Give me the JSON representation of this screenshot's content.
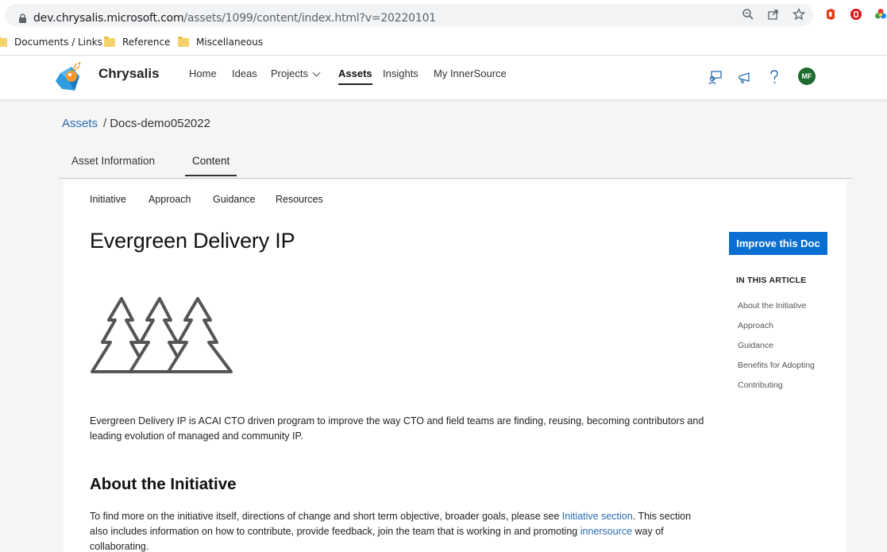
{
  "browser": {
    "url_host": "dev.chrysalis.microsoft.com",
    "url_path": "/assets/1099/content/index.html?v=20220101",
    "bookmarks": [
      "Documents / Links",
      "Reference",
      "Miscellaneous"
    ]
  },
  "header": {
    "brand": "Chrysalis",
    "nav": [
      "Home",
      "Ideas",
      "Projects",
      "Assets",
      "Insights",
      "My InnerSource"
    ],
    "active_nav": "Assets",
    "avatar_initials": "MF",
    "icons": [
      "feedback-icon",
      "announcement-icon",
      "help-icon"
    ]
  },
  "breadcrumb": {
    "link": "Assets",
    "separator": "/",
    "current": "Docs-demo052022"
  },
  "tabs": {
    "items": [
      "Asset Information",
      "Content"
    ],
    "active": "Content"
  },
  "content": {
    "subnav": [
      "Initiative",
      "Approach",
      "Guidance",
      "Resources"
    ],
    "title": "Evergreen Delivery IP",
    "improve_button": "Improve this Doc",
    "toc": {
      "heading": "IN THIS ARTICLE",
      "items": [
        "About the Initiative",
        "Approach",
        "Guidance",
        "Benefits for Adopting",
        "Contributing"
      ]
    },
    "intro": "Evergreen Delivery IP is ACAI CTO driven program to improve the way CTO and field teams are finding, reusing, becoming contributors and leading evolution of managed and community IP.",
    "section_heading": "About the Initiative",
    "section_para": {
      "part1": "To find more on the initiative itself, directions of change and short term objective, broader goals, please see ",
      "link1": "Initiative section",
      "part2": ". This section also includes information on how to contribute, provide feedback, join the team that is working in and promoting ",
      "link2": "innersource",
      "part3": " way of collaborating."
    }
  },
  "colors": {
    "accent": "#0a6fd1",
    "link": "#2b6cb0",
    "avatar": "#1e6b2e"
  }
}
